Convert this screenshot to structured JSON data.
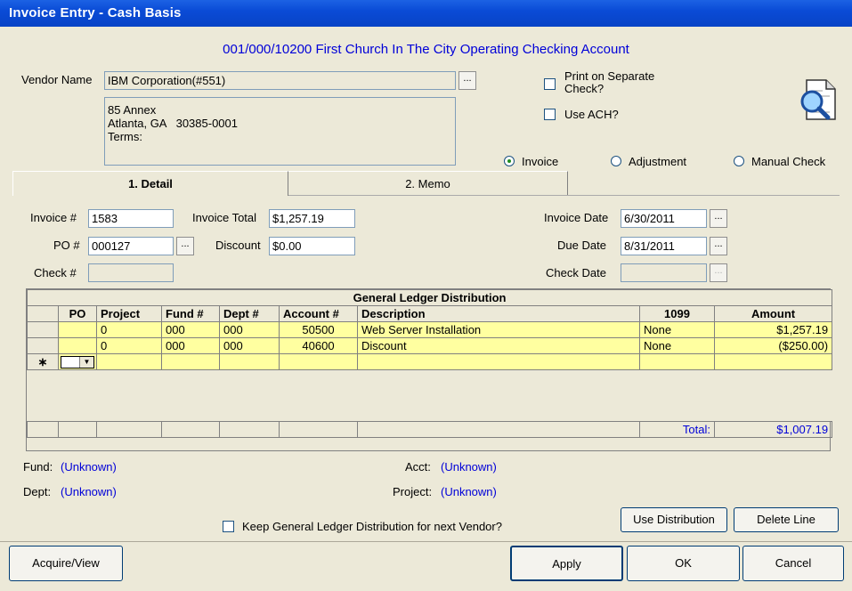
{
  "window": {
    "title": "Invoice Entry - Cash Basis"
  },
  "account": "001/000/10200 First Church In The City Operating Checking Account",
  "vendor": {
    "label": "Vendor Name",
    "value": "IBM Corporation(#551)",
    "address": "85 Annex\nAtlanta, GA   30385-0001\nTerms:"
  },
  "options": {
    "print_separate": "Print on Separate\nCheck?",
    "use_ach": "Use ACH?"
  },
  "type": {
    "invoice": "Invoice",
    "adjustment": "Adjustment",
    "manual_check": "Manual Check",
    "selected": "invoice"
  },
  "tabs": {
    "detail": "1. Detail",
    "memo": "2. Memo"
  },
  "detail": {
    "invoice_no_label": "Invoice #",
    "invoice_no": "1583",
    "invoice_total_label": "Invoice Total",
    "invoice_total": "$1,257.19",
    "invoice_date_label": "Invoice Date",
    "invoice_date": "6/30/2011",
    "po_label": "PO #",
    "po": "000127",
    "discount_label": "Discount",
    "discount": "$0.00",
    "due_date_label": "Due Date",
    "due_date": "8/31/2011",
    "check_no_label": "Check #",
    "check_date_label": "Check Date"
  },
  "gl": {
    "title": "General Ledger Distribution",
    "headers": [
      "PO",
      "Project",
      "Fund #",
      "Dept #",
      "Account #",
      "Description",
      "1099",
      "Amount"
    ],
    "rows": [
      [
        "",
        "0",
        "000",
        "000",
        "50500",
        "Web Server Installation",
        "None",
        "$1,257.19"
      ],
      [
        "",
        "0",
        "000",
        "000",
        "40600",
        "Discount",
        "None",
        "($250.00)"
      ]
    ],
    "new_row_marker": "∗",
    "total_label": "Total:",
    "total": "$1,007.19"
  },
  "info": {
    "fund_label": "Fund:",
    "fund": "(Unknown)",
    "dept_label": "Dept:",
    "dept": "(Unknown)",
    "acct_label": "Acct:",
    "acct": "(Unknown)",
    "project_label": "Project:",
    "project": "(Unknown)"
  },
  "keep_gl": "Keep General Ledger Distribution for next Vendor?",
  "buttons": {
    "use_distribution": "Use Distribution",
    "delete_line": "Delete Line",
    "acquire_view": "Acquire/View",
    "apply": "Apply",
    "ok": "OK",
    "cancel": "Cancel",
    "browse": "..."
  }
}
